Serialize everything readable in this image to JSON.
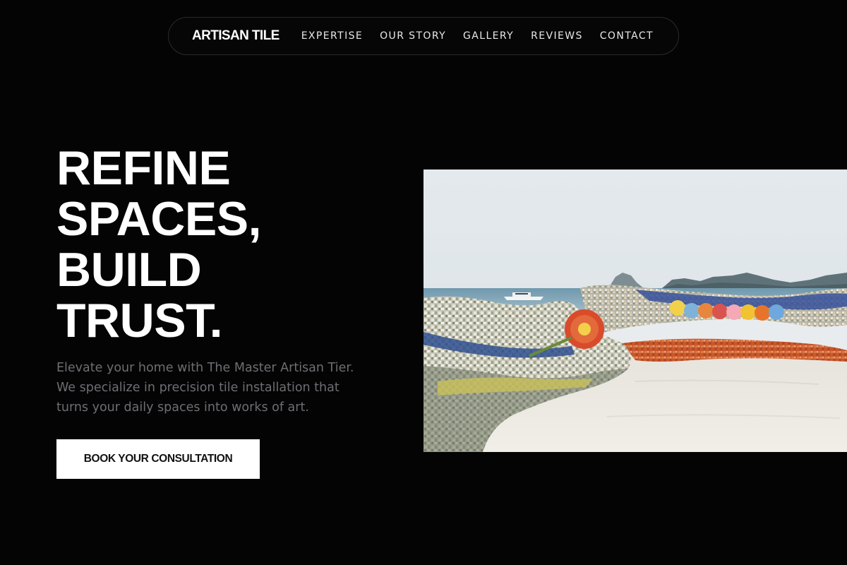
{
  "nav": {
    "brand": "ARTISAN TILE",
    "links": [
      {
        "label": "EXPERTISE"
      },
      {
        "label": "OUR STORY"
      },
      {
        "label": "GALLERY"
      },
      {
        "label": "REVIEWS"
      },
      {
        "label": "CONTACT"
      }
    ]
  },
  "hero": {
    "title_lines": [
      "REFINE",
      "SPACES,",
      "BUILD",
      "TRUST."
    ],
    "subtitle": "Elevate your home with The Master Artisan Tier. We specialize in precision tile installation that turns your daily spaces into works of art.",
    "cta_label": "BOOK YOUR CONSULTATION"
  },
  "colors": {
    "background": "#040404",
    "text": "#ffffff",
    "subtitle": "#6e6e74",
    "cta_bg": "#ffffff",
    "cta_text": "#111111",
    "nav_border": "#2a2a2a"
  }
}
